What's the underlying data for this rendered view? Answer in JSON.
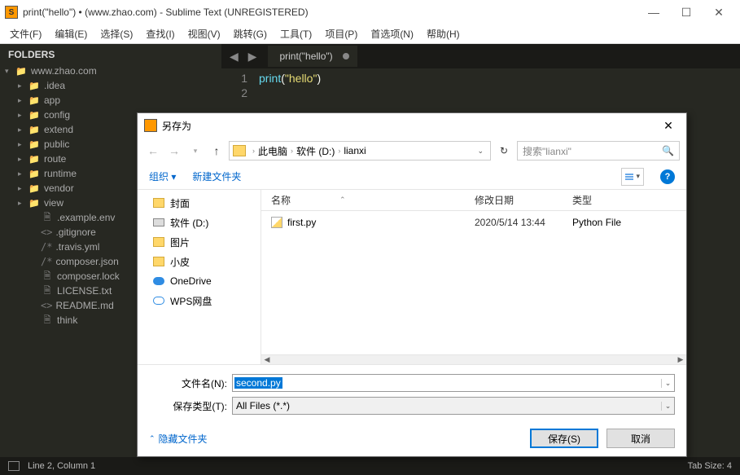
{
  "titlebar": {
    "title": "print(\"hello\") • (www.zhao.com) - Sublime Text (UNREGISTERED)"
  },
  "menubar": [
    "文件(F)",
    "编辑(E)",
    "选择(S)",
    "查找(I)",
    "视图(V)",
    "跳转(G)",
    "工具(T)",
    "项目(P)",
    "首选项(N)",
    "帮助(H)"
  ],
  "sidebar": {
    "header": "FOLDERS",
    "root": "www.zhao.com",
    "folders": [
      ".idea",
      "app",
      "config",
      "extend",
      "public",
      "route",
      "runtime",
      "vendor",
      "view"
    ],
    "files": [
      {
        "pre": "",
        "name": ".example.env"
      },
      {
        "pre": "<>",
        "name": ".gitignore"
      },
      {
        "pre": "/*",
        "name": ".travis.yml"
      },
      {
        "pre": "/*",
        "name": "composer.json"
      },
      {
        "pre": "",
        "name": "composer.lock"
      },
      {
        "pre": "",
        "name": "LICENSE.txt"
      },
      {
        "pre": "<>",
        "name": "README.md"
      },
      {
        "pre": "",
        "name": "think"
      }
    ]
  },
  "editor": {
    "tab": "print(\"hello\")",
    "lines": [
      "1",
      "2"
    ],
    "code": {
      "fn": "print",
      "paren_o": "(",
      "str": "\"hello\"",
      "paren_c": ")"
    }
  },
  "statusbar": {
    "left": "Line 2, Column 1",
    "right": "Tab Size: 4"
  },
  "dialog": {
    "title": "另存为",
    "path": [
      "此电脑",
      "软件 (D:)",
      "lianxi"
    ],
    "search_placeholder": "搜索\"lianxi\"",
    "toolbar": {
      "org": "组织 ▾",
      "newf": "新建文件夹"
    },
    "columns": {
      "name": "名称",
      "date": "修改日期",
      "type": "类型"
    },
    "places": [
      {
        "icon": "fold-y",
        "label": "封面"
      },
      {
        "icon": "drive",
        "label": "软件 (D:)"
      },
      {
        "icon": "fold-y",
        "label": "图片"
      },
      {
        "icon": "fold-y",
        "label": "小皮"
      },
      {
        "icon": "cloud",
        "label": "OneDrive"
      },
      {
        "icon": "cloud-o",
        "label": "WPS网盘"
      }
    ],
    "file": {
      "name": "first.py",
      "date": "2020/5/14 13:44",
      "type": "Python File"
    },
    "fields": {
      "fname_label": "文件名(N):",
      "fname_value": "second.py",
      "ftype_label": "保存类型(T):",
      "ftype_value": "All Files (*.*)"
    },
    "footer": {
      "hide": "隐藏文件夹",
      "save": "保存(S)",
      "cancel": "取消"
    }
  }
}
